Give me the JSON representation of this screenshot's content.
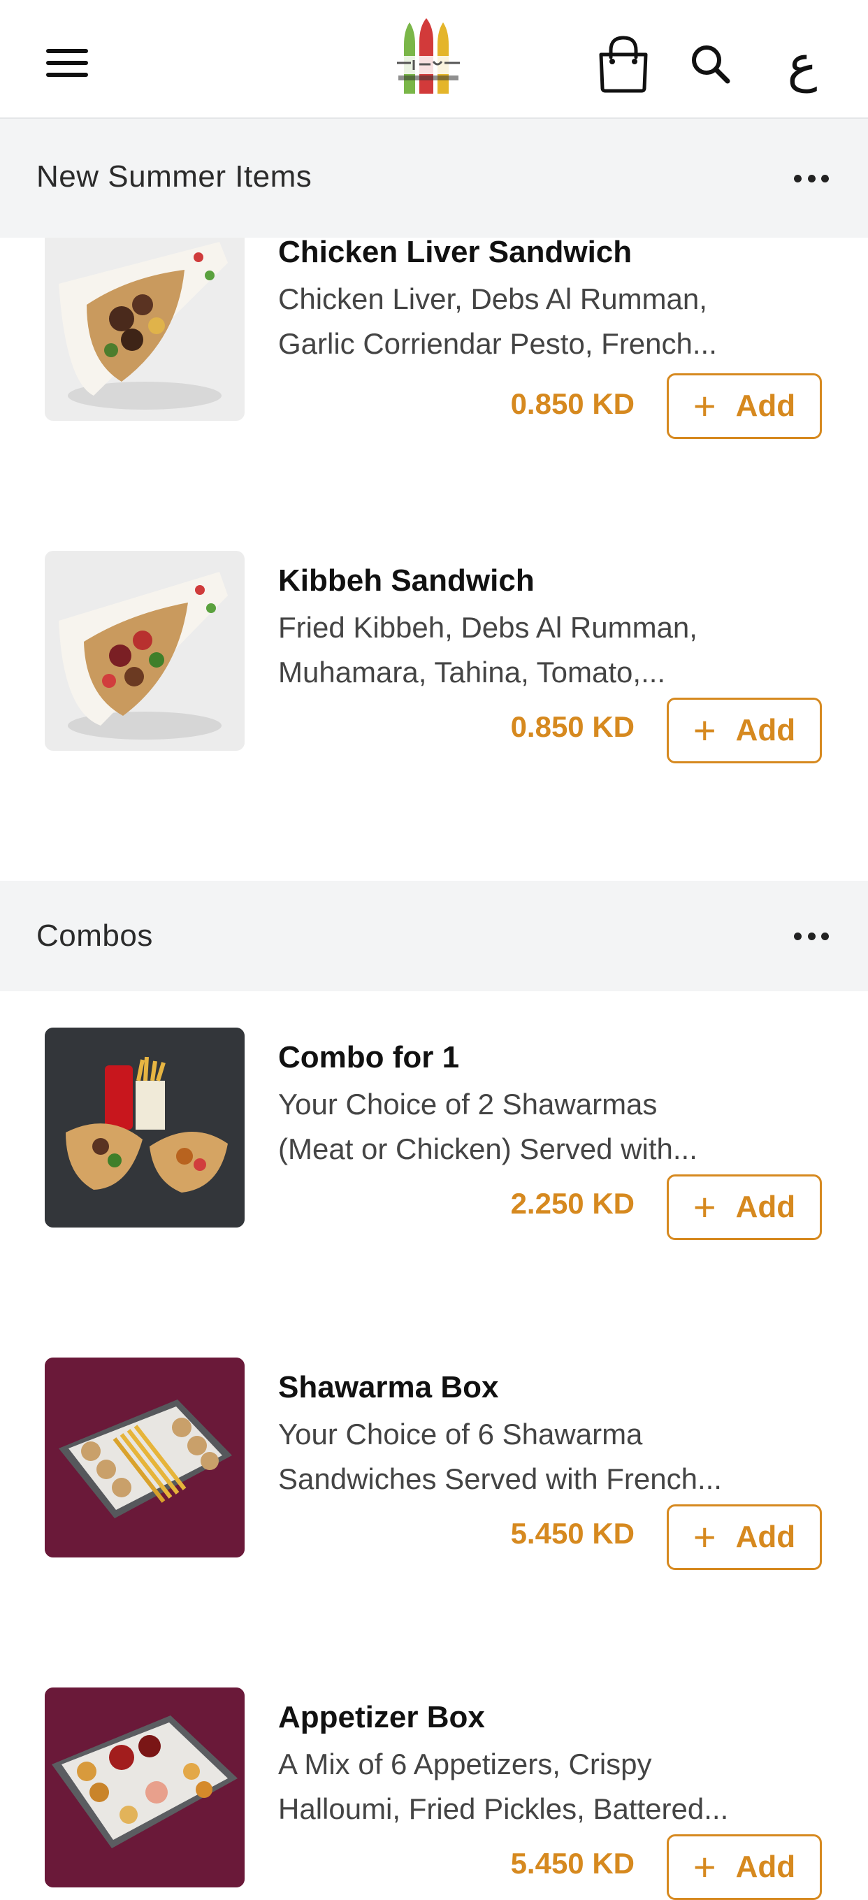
{
  "header": {
    "lang_toggle": "ع",
    "icons": [
      "menu-icon",
      "brand-logo",
      "shopping-bag-icon",
      "search-icon"
    ]
  },
  "sections": [
    {
      "title": "New Summer Items",
      "items": [
        {
          "name": "Chicken Liver Sandwich",
          "desc_line1": "Chicken Liver, Debs Al Rumman,",
          "desc_line2": "Garlic Corriendar Pesto, French...",
          "price": "0.850 KD",
          "add_label": "Add"
        },
        {
          "name": "Kibbeh Sandwich",
          "desc_line1": "Fried Kibbeh, Debs Al Rumman,",
          "desc_line2": "Muhamara, Tahina, Tomato,...",
          "price": "0.850 KD",
          "add_label": "Add"
        }
      ]
    },
    {
      "title": "Combos",
      "items": [
        {
          "name": "Combo for 1",
          "desc_line1": "Your Choice of 2 Shawarmas",
          "desc_line2": "(Meat or Chicken) Served with...",
          "price": "2.250 KD",
          "add_label": "Add"
        },
        {
          "name": "Shawarma Box",
          "desc_line1": "Your Choice of 6 Shawarma",
          "desc_line2": "Sandwiches Served with French...",
          "price": "5.450 KD",
          "add_label": "Add"
        },
        {
          "name": "Appetizer Box",
          "desc_line1": "A Mix of 6 Appetizers, Crispy",
          "desc_line2": "Halloumi, Fried Pickles, Battered...",
          "price": "5.450 KD",
          "add_label": "Add"
        }
      ]
    }
  ],
  "colors": {
    "accent": "#d6891f",
    "section_bg": "#f3f4f5"
  }
}
